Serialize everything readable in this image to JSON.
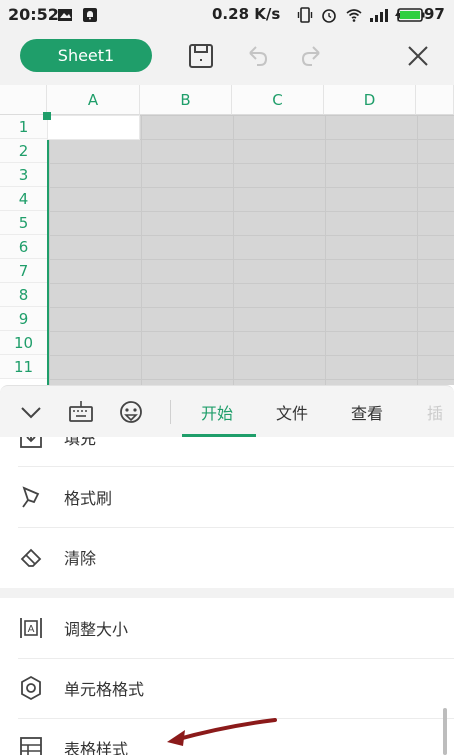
{
  "status_bar": {
    "time": "20:52",
    "network_speed": "0.28 K/s",
    "battery": "97"
  },
  "toolbar": {
    "sheet_name": "Sheet1",
    "icons": [
      "save-icon",
      "undo-icon",
      "redo-icon",
      "close-icon"
    ]
  },
  "sheet": {
    "columns": [
      "A",
      "B",
      "C",
      "D"
    ],
    "rows": [
      "1",
      "2",
      "3",
      "4",
      "5",
      "6",
      "7",
      "8",
      "9",
      "10",
      "11"
    ]
  },
  "tab_bar": {
    "icons": [
      "chevron-down-icon",
      "keyboard-icon",
      "emoji-icon"
    ],
    "tabs": [
      "开始",
      "文件",
      "查看"
    ],
    "active_tab": "开始",
    "partial_tab": "插"
  },
  "menu": {
    "items": [
      {
        "label": "填充",
        "icon": "fill-icon"
      },
      {
        "label": "格式刷",
        "icon": "format-painter-icon"
      },
      {
        "label": "清除",
        "icon": "eraser-icon"
      },
      {
        "label": "调整大小",
        "icon": "resize-icon"
      },
      {
        "label": "单元格格式",
        "icon": "gear-icon"
      },
      {
        "label": "表格样式",
        "icon": "table-style-icon"
      }
    ]
  },
  "colors": {
    "accent": "#1f9e6a",
    "annotation_arrow": "#8b1a1a"
  }
}
